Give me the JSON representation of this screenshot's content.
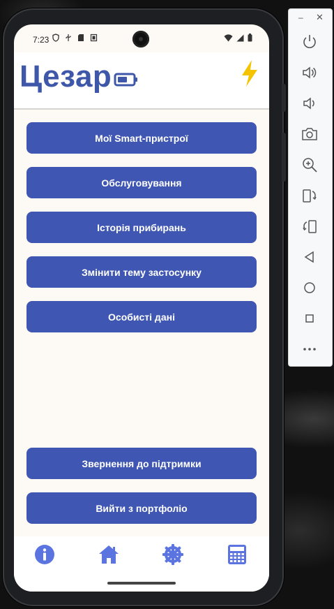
{
  "status_bar": {
    "time": "7:23"
  },
  "app": {
    "title": "Цезар"
  },
  "menu": {
    "items": [
      {
        "label": "Мої Smart-пристрої"
      },
      {
        "label": "Обслуговування"
      },
      {
        "label": "Історія прибирань"
      },
      {
        "label": "Змінити тему застосунку"
      },
      {
        "label": "Особисті дані"
      }
    ],
    "support_label": "Звернення до підтримки",
    "logout_label": "Вийти з портфоліо"
  },
  "bottom_nav": {
    "items": [
      {
        "icon": "info-icon"
      },
      {
        "icon": "home-icon"
      },
      {
        "icon": "settings-icon"
      },
      {
        "icon": "calculator-icon"
      }
    ]
  },
  "emulator_panel": {
    "buttons": [
      "power-icon",
      "volume-up-icon",
      "volume-down-icon",
      "camera-icon",
      "zoom-in-icon",
      "rotate-left-icon",
      "rotate-right-icon",
      "back-icon",
      "home-circle-icon",
      "overview-icon",
      "more-icon"
    ]
  },
  "colors": {
    "primary": "#3f57b3",
    "title": "#3f57a8",
    "accent_bolt": "#f5c400",
    "nav_icon": "#5b74e0",
    "screen_bg": "#fdf9f4"
  }
}
